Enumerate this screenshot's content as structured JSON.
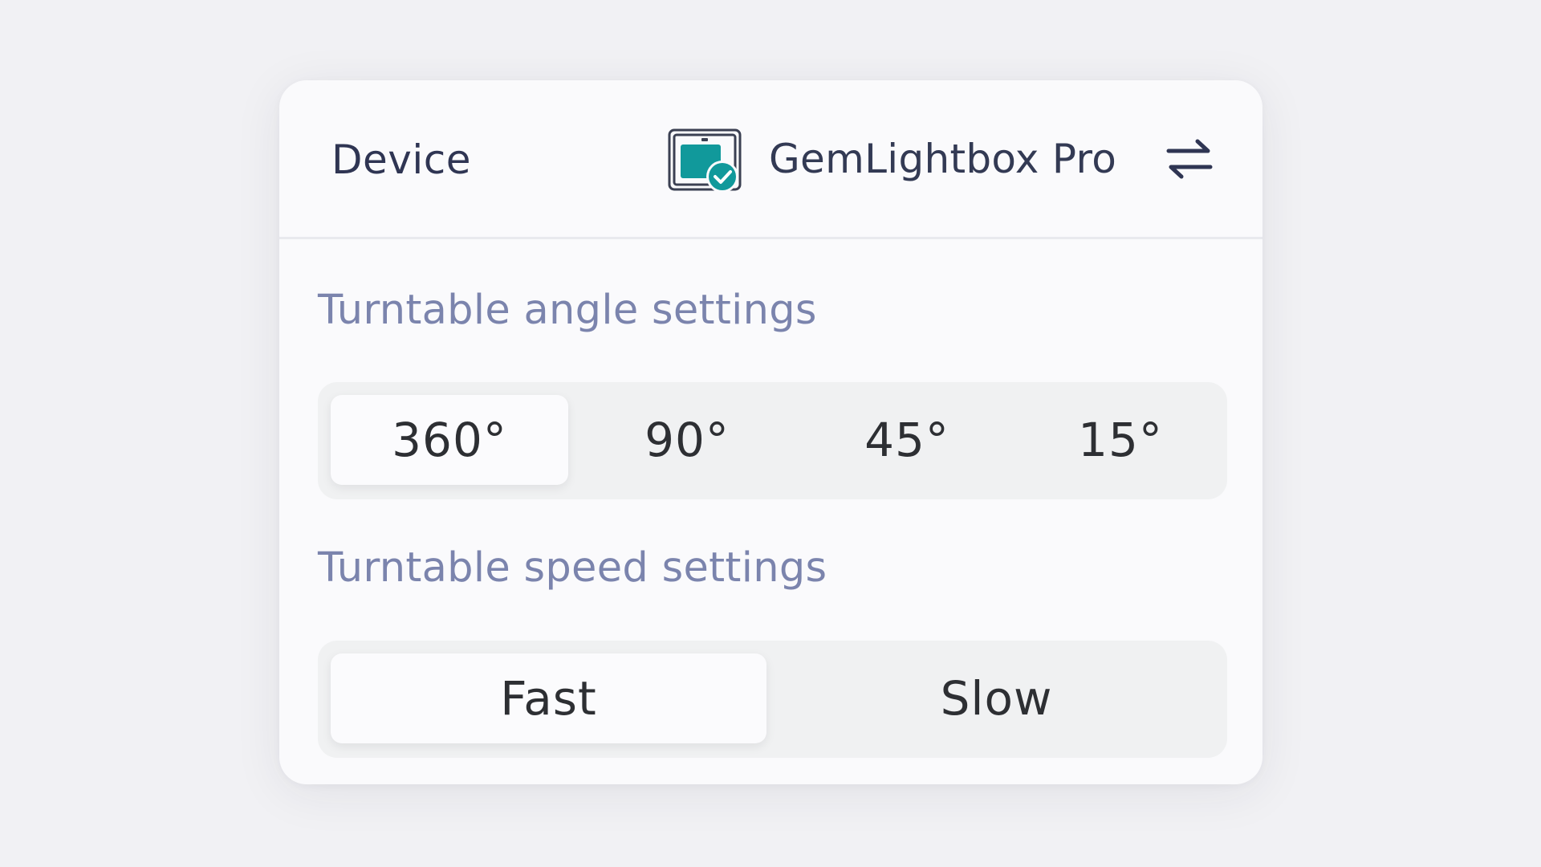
{
  "header": {
    "label": "Device",
    "device_name": "GemLightbox Pro",
    "device_icon": "lightbox-connected-icon",
    "swap_icon": "swap-arrows-icon",
    "accent_color": "#11999b"
  },
  "angle": {
    "title": "Turntable angle settings",
    "options": [
      "360°",
      "90°",
      "45°",
      "15°"
    ],
    "selected": "360°"
  },
  "speed": {
    "title": "Turntable speed settings",
    "options": [
      "Fast",
      "Slow"
    ],
    "selected": "Fast"
  }
}
